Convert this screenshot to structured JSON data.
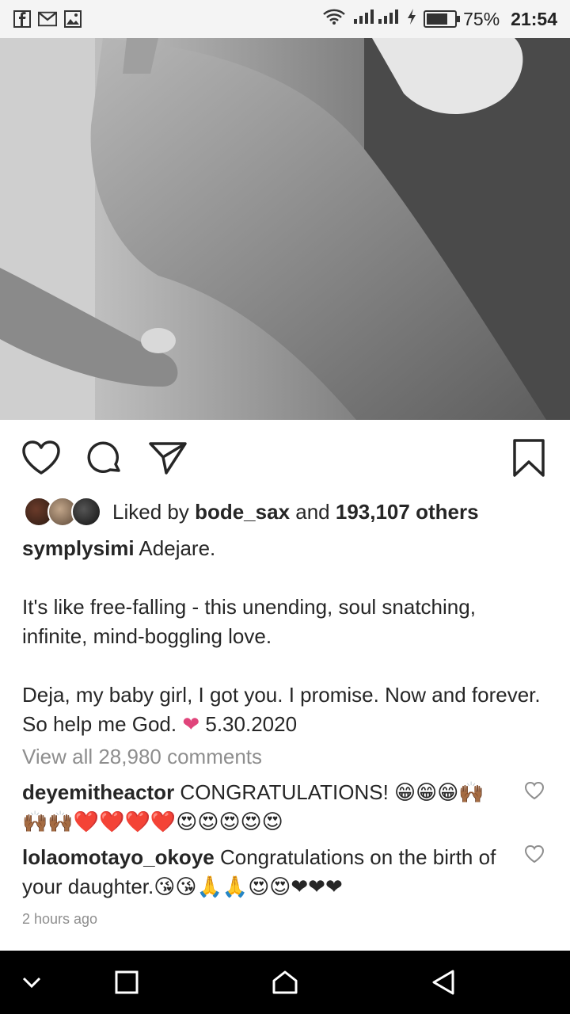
{
  "status_bar": {
    "icons_left": [
      "facebook-icon",
      "gmail-icon",
      "gallery-icon"
    ],
    "battery_percent": "75%",
    "battery_level": 0.75,
    "time": "21:54"
  },
  "post": {
    "likes": {
      "prefix": "Liked by ",
      "user": "bode_sax",
      "middle": " and ",
      "others": "193,107 others"
    },
    "caption": {
      "username": "symplysimi",
      "line1": " Adejare.",
      "para2": "It's like free-falling - this unending, soul snatching, infinite, mind-boggling love.",
      "para3": "Deja, my baby girl, I got you. I promise. Now and forever. So help me God. ",
      "heart": "❤",
      "date": " 5.30.2020"
    },
    "view_all": "View all 28,980 comments",
    "comments": [
      {
        "username": "deyemitheactor",
        "text": " CONGRATULATIONS! 😁😁😁🙌🏾🙌🏾🙌🏾❤️❤️❤️❤️😍😍😍😍😍"
      },
      {
        "username": "lolaomotayo_okoye",
        "text": " Congratulations on the birth of your daughter.😘😘🙏🙏😍😍❤❤❤"
      }
    ],
    "timestamp": "2 hours ago"
  },
  "colors": {
    "accent_pink": "#e0457b",
    "muted": "#8e8e8e",
    "nav_bg": "#000000"
  }
}
